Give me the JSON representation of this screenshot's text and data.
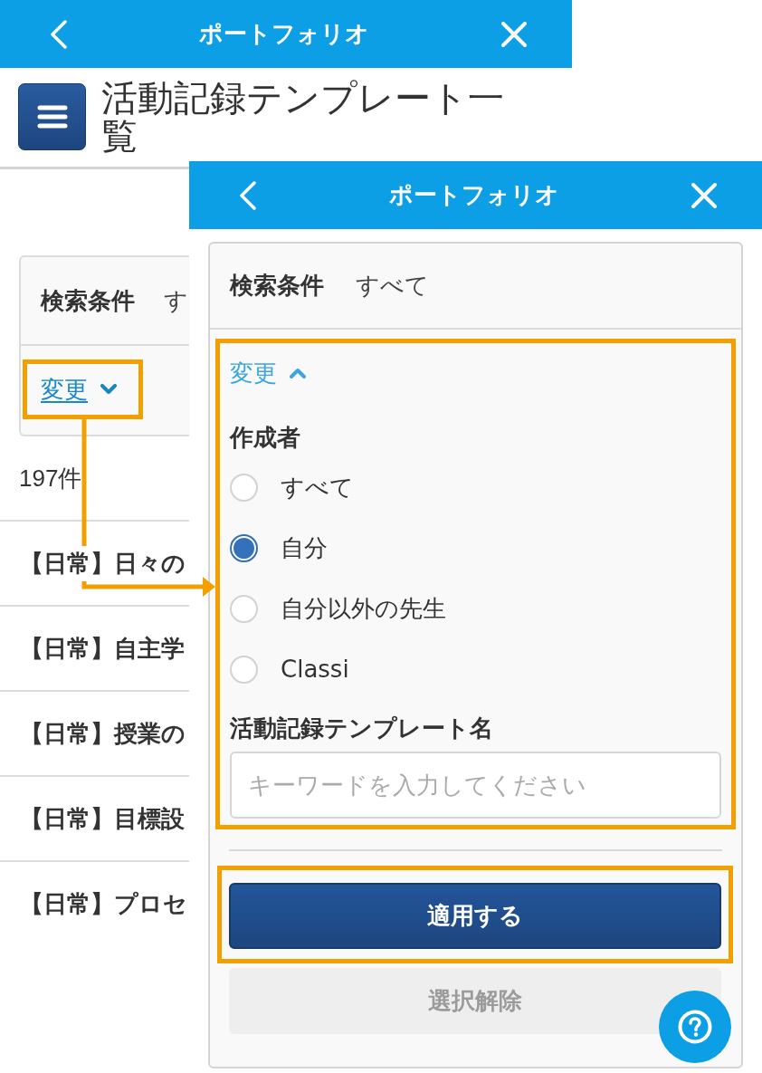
{
  "back_screen": {
    "header": {
      "title": "ポートフォリオ"
    },
    "page_title": "活動記録テンプレート一覧",
    "search_summary": {
      "label": "検索条件",
      "value": "す"
    },
    "change_link": {
      "label": "変更",
      "expanded": false
    },
    "result_count": "197件",
    "rows": [
      "【日常】日々の",
      "【日常】自主学",
      "【日常】授業の",
      "【日常】目標設",
      "【日常】プロセ"
    ]
  },
  "front_screen": {
    "header": {
      "title": "ポートフォリオ"
    },
    "search_summary": {
      "label": "検索条件",
      "value": "すべて"
    },
    "change_link": {
      "label": "変更",
      "expanded": true
    },
    "creator_filter": {
      "label": "作成者",
      "options": [
        {
          "label": "すべて",
          "selected": false
        },
        {
          "label": "自分",
          "selected": true
        },
        {
          "label": "自分以外の先生",
          "selected": false
        },
        {
          "label": "Classi",
          "selected": false
        }
      ]
    },
    "template_name_filter": {
      "label": "活動記録テンプレート名",
      "placeholder": "キーワードを入力してください"
    },
    "buttons": [
      {
        "label": "適用する",
        "kind": "primary"
      },
      {
        "label": "選択解除",
        "kind": "secondary"
      }
    ]
  }
}
